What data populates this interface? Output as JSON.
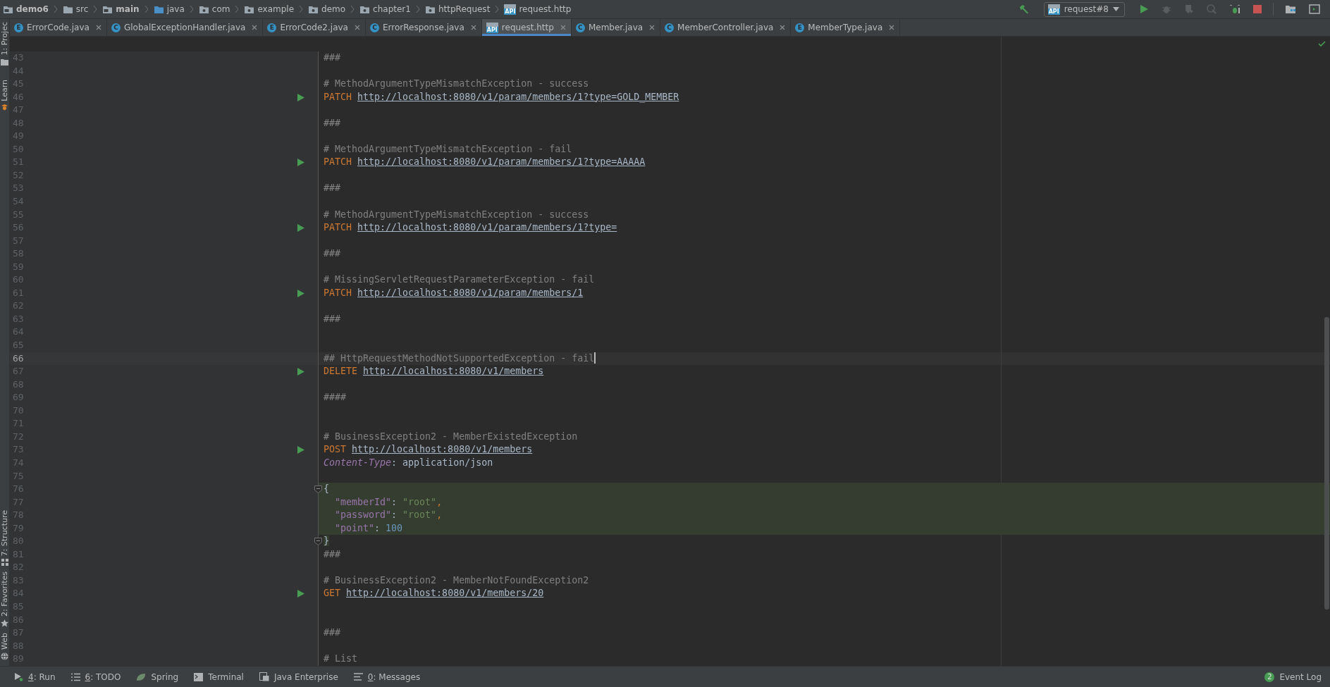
{
  "breadcrumb": [
    {
      "label": "demo6",
      "kind": "module",
      "bold": true
    },
    {
      "label": "src",
      "kind": "folder",
      "bold": false
    },
    {
      "label": "main",
      "kind": "module",
      "bold": true
    },
    {
      "label": "java",
      "kind": "source",
      "bold": false
    },
    {
      "label": "com",
      "kind": "package",
      "bold": false
    },
    {
      "label": "example",
      "kind": "package",
      "bold": false
    },
    {
      "label": "demo",
      "kind": "package",
      "bold": false
    },
    {
      "label": "chapter1",
      "kind": "package",
      "bold": false
    },
    {
      "label": "httpRequest",
      "kind": "package",
      "bold": false
    },
    {
      "label": "request.http",
      "kind": "http",
      "badge": "API",
      "bold": false
    }
  ],
  "run_config": {
    "label": "request#8",
    "badge": "API"
  },
  "tool_strip": {
    "top": [
      {
        "label": "1: Projec",
        "kind": "project"
      },
      {
        "label": "Learn",
        "kind": "learn"
      }
    ],
    "bottom": [
      {
        "label": "7: Structure",
        "kind": "structure"
      },
      {
        "label": "2: Favorites",
        "kind": "favorites"
      },
      {
        "label": "Web",
        "kind": "web"
      }
    ]
  },
  "tabs": [
    {
      "label": "ErrorCode.java",
      "kind": "class",
      "badge": "E",
      "selected": false
    },
    {
      "label": "GlobalExceptionHandler.java",
      "kind": "class",
      "badge": "C",
      "selected": false
    },
    {
      "label": "ErrorCode2.java",
      "kind": "class",
      "badge": "E",
      "selected": false
    },
    {
      "label": "ErrorResponse.java",
      "kind": "class",
      "badge": "C",
      "selected": false
    },
    {
      "label": "request.http",
      "kind": "http",
      "badge": "API",
      "selected": true
    },
    {
      "label": "Member.java",
      "kind": "class",
      "badge": "C",
      "selected": false
    },
    {
      "label": "MemberController.java",
      "kind": "class",
      "badge": "C",
      "selected": false
    },
    {
      "label": "MemberType.java",
      "kind": "class",
      "badge": "E",
      "selected": false
    }
  ],
  "editor": {
    "lines": [
      {
        "number": "43",
        "tokens": [
          {
            "kind": "comment",
            "text": "###"
          }
        ]
      },
      {
        "number": "44"
      },
      {
        "number": "45",
        "tokens": [
          {
            "kind": "comment",
            "text": "# MethodArgumentTypeMismatchException - success"
          }
        ]
      },
      {
        "number": "46",
        "run": true,
        "tokens": [
          {
            "kind": "method",
            "text": "PATCH"
          },
          {
            "kind": "url",
            "text": "http://localhost:8080/v1/param/members/1?type=GOLD_MEMBER"
          }
        ]
      },
      {
        "number": "47"
      },
      {
        "number": "48",
        "tokens": [
          {
            "kind": "comment",
            "text": "###"
          }
        ]
      },
      {
        "number": "49"
      },
      {
        "number": "50",
        "tokens": [
          {
            "kind": "comment",
            "text": "# MethodArgumentTypeMismatchException - fail"
          }
        ]
      },
      {
        "number": "51",
        "run": true,
        "tokens": [
          {
            "kind": "method",
            "text": "PATCH"
          },
          {
            "kind": "url",
            "text": "http://localhost:8080/v1/param/members/1?type=AAAAA"
          }
        ]
      },
      {
        "number": "52"
      },
      {
        "number": "53",
        "tokens": [
          {
            "kind": "comment",
            "text": "###"
          }
        ]
      },
      {
        "number": "54"
      },
      {
        "number": "55",
        "tokens": [
          {
            "kind": "comment",
            "text": "# MethodArgumentTypeMismatchException - success"
          }
        ]
      },
      {
        "number": "56",
        "run": true,
        "tokens": [
          {
            "kind": "method",
            "text": "PATCH"
          },
          {
            "kind": "url",
            "text": "http://localhost:8080/v1/param/members/1?type="
          }
        ]
      },
      {
        "number": "57"
      },
      {
        "number": "58",
        "tokens": [
          {
            "kind": "comment",
            "text": "###"
          }
        ]
      },
      {
        "number": "59"
      },
      {
        "number": "60",
        "tokens": [
          {
            "kind": "comment",
            "text": "# MissingServletRequestParameterException - fail"
          }
        ]
      },
      {
        "number": "61",
        "run": true,
        "tokens": [
          {
            "kind": "method",
            "text": "PATCH"
          },
          {
            "kind": "url",
            "text": "http://localhost:8080/v1/param/members/1"
          }
        ]
      },
      {
        "number": "62"
      },
      {
        "number": "63",
        "tokens": [
          {
            "kind": "comment",
            "text": "###"
          }
        ]
      },
      {
        "number": "64"
      },
      {
        "number": "65"
      },
      {
        "number": "66",
        "current": true,
        "caret": true,
        "tokens": [
          {
            "kind": "comment",
            "text": "## HttpRequestMethodNotSupportedException - fail"
          }
        ]
      },
      {
        "number": "67",
        "run": true,
        "tokens": [
          {
            "kind": "method",
            "text": "DELETE"
          },
          {
            "kind": "url",
            "text": "http://localhost:8080/v1/members"
          }
        ]
      },
      {
        "number": "68"
      },
      {
        "number": "69",
        "tokens": [
          {
            "kind": "comment",
            "text": "####"
          }
        ]
      },
      {
        "number": "70"
      },
      {
        "number": "71"
      },
      {
        "number": "72",
        "tokens": [
          {
            "kind": "comment",
            "text": "# BusinessException2 - MemberExistedException"
          }
        ]
      },
      {
        "number": "73",
        "run": true,
        "tokens": [
          {
            "kind": "method",
            "text": "POST"
          },
          {
            "kind": "url",
            "text": "http://localhost:8080/v1/members"
          }
        ]
      },
      {
        "number": "74",
        "tokens": [
          {
            "kind": "header",
            "text": "Content-Type"
          },
          {
            "kind": "punct",
            "text": ":"
          },
          {
            "kind": "value",
            "text": "application/json"
          }
        ]
      },
      {
        "number": "75"
      },
      {
        "number": "76",
        "fold": true,
        "injected": true,
        "tokens": [
          {
            "kind": "brace",
            "text": "{"
          }
        ]
      },
      {
        "number": "77",
        "injected": true,
        "indent": true,
        "tokens": [
          {
            "kind": "key",
            "text": "\"memberId\""
          },
          {
            "kind": "punct",
            "text": ":"
          },
          {
            "kind": "string",
            "text": "\"root\""
          },
          {
            "kind": "comma",
            "text": ","
          }
        ]
      },
      {
        "number": "78",
        "injected": true,
        "indent": true,
        "tokens": [
          {
            "kind": "key",
            "text": "\"password\""
          },
          {
            "kind": "punct",
            "text": ":"
          },
          {
            "kind": "string",
            "text": "\"root\""
          },
          {
            "kind": "comma",
            "text": ","
          }
        ]
      },
      {
        "number": "79",
        "injected": true,
        "indent": true,
        "tokens": [
          {
            "kind": "key",
            "text": "\"point\""
          },
          {
            "kind": "punct",
            "text": ":"
          },
          {
            "kind": "number",
            "text": "100"
          }
        ]
      },
      {
        "number": "80",
        "fold": true,
        "tokens": [
          {
            "kind": "brace",
            "text": "}"
          }
        ]
      },
      {
        "number": "81",
        "tokens": [
          {
            "kind": "comment",
            "text": "###"
          }
        ]
      },
      {
        "number": "82"
      },
      {
        "number": "83",
        "tokens": [
          {
            "kind": "comment",
            "text": "# BusinessException2 - MemberNotFoundException2"
          }
        ]
      },
      {
        "number": "84",
        "run": true,
        "tokens": [
          {
            "kind": "method",
            "text": "GET"
          },
          {
            "kind": "url",
            "text": "http://localhost:8080/v1/members/20"
          }
        ]
      },
      {
        "number": "85"
      },
      {
        "number": "86"
      },
      {
        "number": "87",
        "tokens": [
          {
            "kind": "comment",
            "text": "###"
          }
        ]
      },
      {
        "number": "88"
      },
      {
        "number": "89",
        "tokens": [
          {
            "kind": "comment",
            "text": "# List"
          }
        ]
      }
    ]
  },
  "bottom_bar": {
    "tools": [
      {
        "kind": "run",
        "mnemonic": "4",
        "label": ": Run"
      },
      {
        "kind": "todo",
        "mnemonic": "6",
        "label": ": TODO"
      },
      {
        "kind": "spring",
        "label": "Spring"
      },
      {
        "kind": "terminal",
        "label": "Terminal"
      },
      {
        "kind": "enterprise",
        "label": "Java Enterprise"
      },
      {
        "kind": "messages",
        "mnemonic": "0",
        "label": ": Messages"
      }
    ],
    "event_log": {
      "count": "2",
      "label": "Event Log"
    }
  }
}
